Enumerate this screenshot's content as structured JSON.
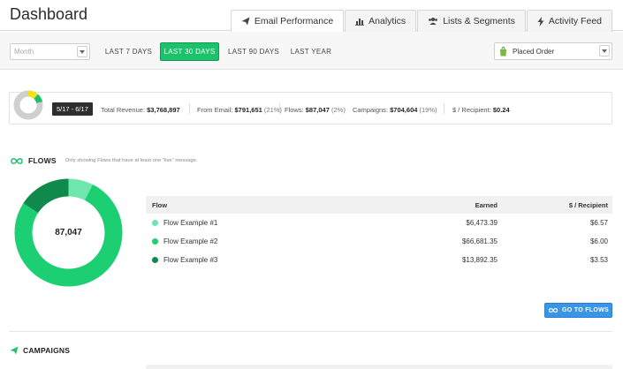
{
  "header": {
    "title": "Dashboard",
    "tabs": [
      {
        "label": "Email Performance",
        "icon": "paper-plane-icon",
        "active": true
      },
      {
        "label": "Analytics",
        "icon": "bar-chart-icon",
        "active": false
      },
      {
        "label": "Lists & Segments",
        "icon": "users-icon",
        "active": false
      },
      {
        "label": "Activity Feed",
        "icon": "bolt-icon",
        "active": false
      }
    ]
  },
  "filters": {
    "month_placeholder": "Month",
    "ranges": [
      {
        "label": "LAST 7 DAYS",
        "active": false
      },
      {
        "label": "LAST 30 DAYS",
        "active": true
      },
      {
        "label": "LAST 90 DAYS",
        "active": false
      },
      {
        "label": "LAST YEAR",
        "active": false
      }
    ],
    "metric": "Placed Order"
  },
  "summary": {
    "date_range": "5/17 - 6/17",
    "total_revenue_label": "Total Revenue:",
    "total_revenue": "$3,768,897",
    "from_email_label": "From Email:",
    "from_email": "$791,651",
    "from_email_pct": "(21%)",
    "flows_label": "Flows:",
    "flows": "$87,047",
    "flows_pct": "(2%)",
    "campaigns_label": "Campaigns:",
    "campaigns": "$704,604",
    "campaigns_pct": "(19%)",
    "per_recipient_label": "$ / Recipient:",
    "per_recipient": "$0.24",
    "email_share": 0.21
  },
  "flows": {
    "title": "FLOWS",
    "note": "Only showing Flows that have at least one \"live\" message.",
    "total": "87,047",
    "columns": {
      "flow": "Flow",
      "earned": "Earned",
      "per_recipient": "$ / Recipient"
    },
    "rows": [
      {
        "name": "Flow Example #1",
        "earned": "$6,473.39",
        "per_recipient": "$6.57",
        "color": "#6ee6ad",
        "value": 6473.39
      },
      {
        "name": "Flow Example #2",
        "earned": "$66,681.35",
        "per_recipient": "$6.00",
        "color": "#1bcf72",
        "value": 66681.35
      },
      {
        "name": "Flow Example #3",
        "earned": "$13,892.35",
        "per_recipient": "$3.53",
        "color": "#108a4c",
        "value": 13892.35
      }
    ],
    "button": "GO TO FLOWS"
  },
  "campaigns": {
    "title": "CAMPAIGNS"
  },
  "colors": {
    "accent": "#19c26b",
    "button_blue": "#3b95e6"
  }
}
